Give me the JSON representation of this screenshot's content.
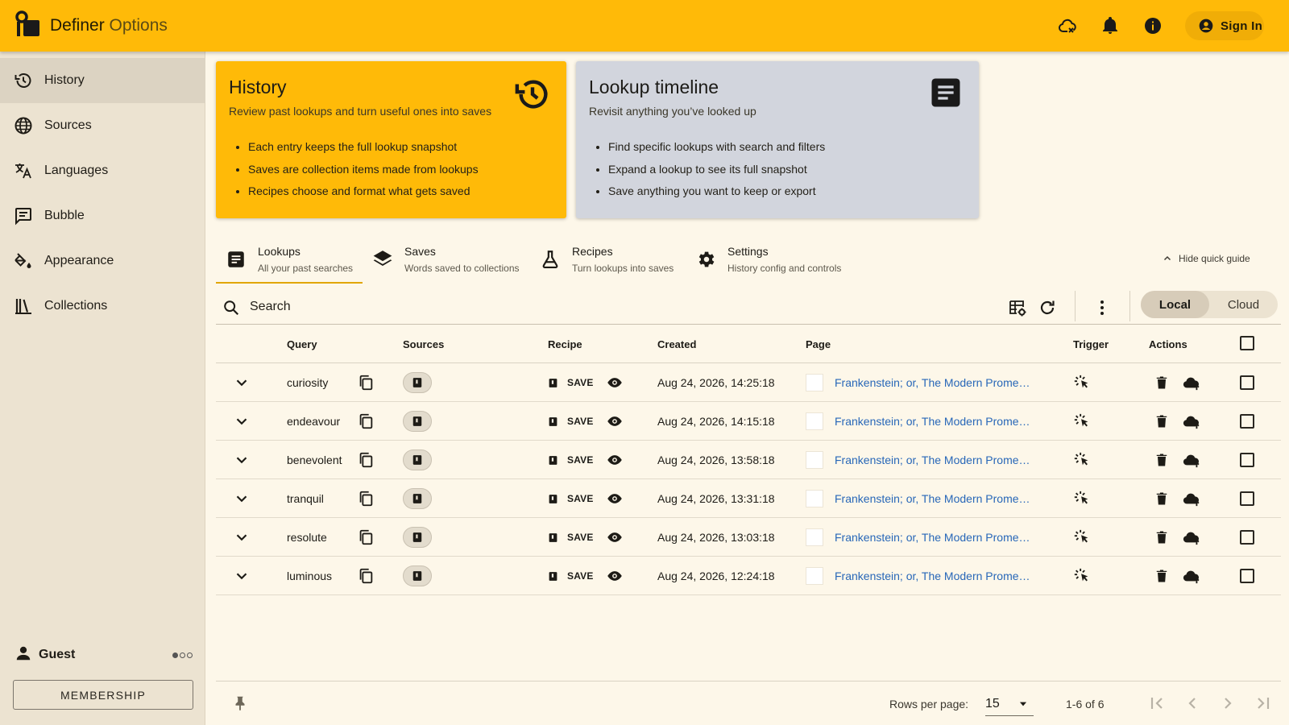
{
  "colors": {
    "header_bg": "#ffba08",
    "sidebar_bg": "#ece3d1",
    "page_bg": "#fdf7e9",
    "timeline_card_bg": "#d2d5dd",
    "link": "#2867b8"
  },
  "header": {
    "title_primary": "Definer",
    "title_secondary": "Options",
    "icons": [
      "cloud-off-icon",
      "bell-icon",
      "info-icon"
    ],
    "sign_in_label": "Sign In"
  },
  "sidebar": {
    "items": [
      {
        "label": "History",
        "icon": "history-icon",
        "active": true
      },
      {
        "label": "Sources",
        "icon": "globe-icon"
      },
      {
        "label": "Languages",
        "icon": "translate-icon"
      },
      {
        "label": "Bubble",
        "icon": "message-icon"
      },
      {
        "label": "Appearance",
        "icon": "paint-bucket-icon"
      },
      {
        "label": "Collections",
        "icon": "library-icon"
      }
    ],
    "user_name": "Guest",
    "membership_label": "MEMBERSHIP"
  },
  "guide": {
    "history": {
      "title": "History",
      "description": "Review past lookups and turn useful ones into saves",
      "bullets": [
        "Each entry keeps the full lookup snapshot",
        "Saves are collection items made from lookups",
        "Recipes choose and format what gets saved"
      ]
    },
    "timeline": {
      "title": "Lookup timeline",
      "description": "Revisit anything you’ve looked up",
      "bullets": [
        "Find specific lookups with search and filters",
        "Expand a lookup to see its full snapshot",
        "Save anything you want to keep or export"
      ]
    }
  },
  "tabs": [
    {
      "title": "Lookups",
      "subtitle": "All your past searches",
      "icon": "list-icon",
      "active": true
    },
    {
      "title": "Saves",
      "subtitle": "Words saved to collections",
      "icon": "layers-icon"
    },
    {
      "title": "Recipes",
      "subtitle": "Turn lookups into saves",
      "icon": "flask-icon"
    },
    {
      "title": "Settings",
      "subtitle": "History config and controls",
      "icon": "gear-icon"
    }
  ],
  "hide_guide_label": "Hide quick guide",
  "toolbar": {
    "search_placeholder": "Search",
    "segment": {
      "local": "Local",
      "cloud": "Cloud",
      "selected": "Local"
    }
  },
  "table": {
    "columns": [
      "Query",
      "Sources",
      "Recipe",
      "Created",
      "Page",
      "Trigger",
      "Actions"
    ],
    "rows": [
      {
        "query": "curiosity",
        "recipe": "SAVE",
        "created": "Aug 24, 2026, 14:25:18",
        "page": "Frankenstein; or, The Modern Prometheus"
      },
      {
        "query": "endeavour",
        "recipe": "SAVE",
        "created": "Aug 24, 2026, 14:15:18",
        "page": "Frankenstein; or, The Modern Prometheus"
      },
      {
        "query": "benevolent",
        "recipe": "SAVE",
        "created": "Aug 24, 2026, 13:58:18",
        "page": "Frankenstein; or, The Modern Prometheus"
      },
      {
        "query": "tranquil",
        "recipe": "SAVE",
        "created": "Aug 24, 2026, 13:31:18",
        "page": "Frankenstein; or, The Modern Prometheus"
      },
      {
        "query": "resolute",
        "recipe": "SAVE",
        "created": "Aug 24, 2026, 13:03:18",
        "page": "Frankenstein; or, The Modern Prometheus"
      },
      {
        "query": "luminous",
        "recipe": "SAVE",
        "created": "Aug 24, 2026, 12:24:18",
        "page": "Frankenstein; or, The Modern Prometheus"
      }
    ]
  },
  "pagination": {
    "rows_per_page_label": "Rows per page:",
    "rows_per_page": "15",
    "range": "1-6 of 6"
  }
}
